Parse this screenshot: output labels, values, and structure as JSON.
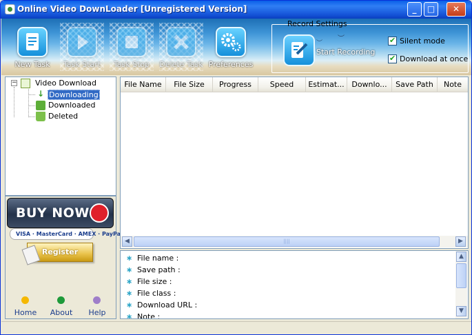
{
  "window": {
    "title": "Online Video DownLoader [Unregistered Version]",
    "controls": {
      "minimize": "_",
      "maximize": "□",
      "close": "✕"
    }
  },
  "toolbar": {
    "buttons": [
      {
        "label": "New Task",
        "icon": "document-icon",
        "enabled": true
      },
      {
        "label": "Task Start",
        "icon": "play-icon",
        "enabled": false
      },
      {
        "label": "Task Stop",
        "icon": "stop-icon",
        "enabled": false
      },
      {
        "label": "Delete Task",
        "icon": "delete-icon",
        "enabled": false
      },
      {
        "label": "Preferences",
        "icon": "gears-icon",
        "enabled": true
      }
    ],
    "record_settings": {
      "legend": "Record Settings",
      "start_label": "Start Recording",
      "silent_mode": {
        "label": "Silent mode",
        "checked": true
      },
      "download_at_once": {
        "label": "Download at once",
        "checked": true
      }
    }
  },
  "tree": {
    "root": "Video Download",
    "expander": "−",
    "children": [
      {
        "label": "Downloading",
        "icon": "down-arrow-icon",
        "selected": true
      },
      {
        "label": "Downloaded",
        "icon": "downloaded-icon",
        "selected": false
      },
      {
        "label": "Deleted",
        "icon": "trash-icon",
        "selected": false
      }
    ]
  },
  "promo": {
    "buy_now": "BUY NOW",
    "cards": "VISA · MasterCard · AMEX · PayPal",
    "register": "Register"
  },
  "nav": [
    {
      "label": "Home",
      "color": "#f5b800"
    },
    {
      "label": "About",
      "color": "#1e9a3a"
    },
    {
      "label": "Help",
      "color": "#9f7ec9"
    }
  ],
  "table": {
    "columns": [
      "File Name",
      "File Size",
      "Progress",
      "Speed",
      "Estimat...",
      "Downlo...",
      "Save Path",
      "Note"
    ],
    "rows": []
  },
  "scroll": {
    "left": "◀",
    "right": "▶",
    "up": "▲",
    "down": "▼",
    "grip": "||||"
  },
  "info": {
    "bullet": "∗",
    "fields": [
      "File name :",
      "Save path :",
      "File size :",
      "File class :",
      "Download URL :",
      "Note :"
    ]
  }
}
